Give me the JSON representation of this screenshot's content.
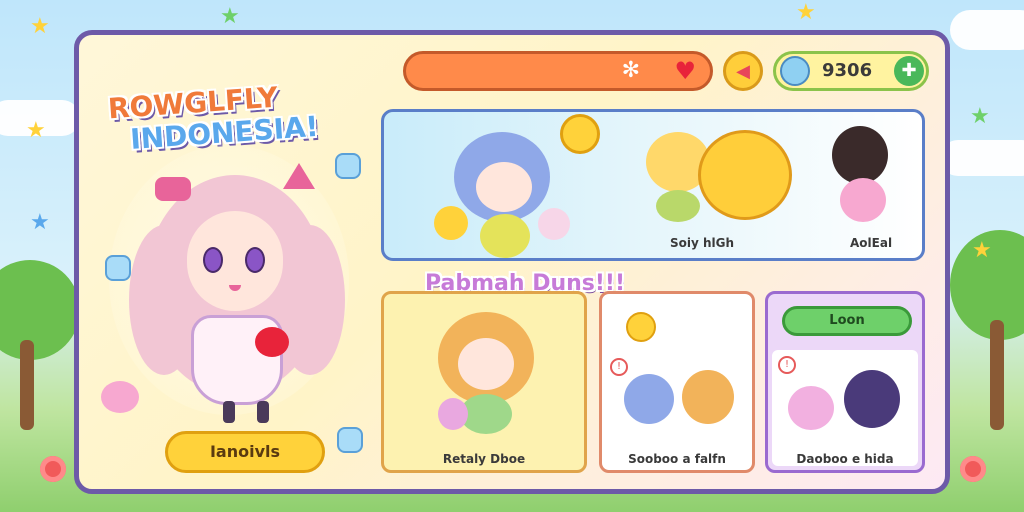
{
  "game": {
    "title_line1": "ROWGLFLY",
    "title_line2": "INDONESIA!"
  },
  "topbar": {
    "currency_value": "9306",
    "sparkle_icon": "sparkle-icon",
    "heart_icon": "heart-icon",
    "plus_icon": "plus-icon"
  },
  "left": {
    "play_label": "Ianoivls"
  },
  "featured": {
    "item2_label": "Soiy hlGh",
    "item3_label": "AolEal"
  },
  "section": {
    "title": "Pabmah Duns!!!"
  },
  "cards": [
    {
      "label": "Retaly Dboe"
    },
    {
      "label": "Sooboo a falfn"
    },
    {
      "label": "Daoboo e hida",
      "button": "Loon"
    }
  ],
  "colors": {
    "panel_border": "#6d5aa8",
    "accent_orange": "#ff8a4a",
    "accent_yellow": "#ffd23a",
    "accent_green": "#6ed06a",
    "accent_purple": "#c77ad8"
  }
}
